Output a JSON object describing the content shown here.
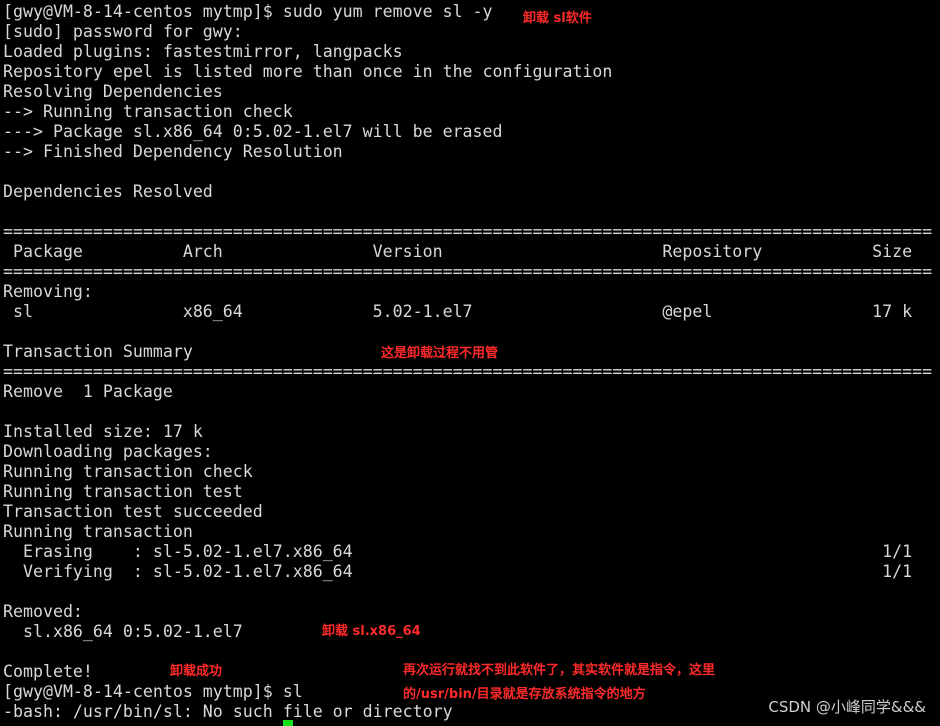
{
  "terminal": {
    "lines": [
      "[gwy@VM-8-14-centos mytmp]$ sudo yum remove sl -y",
      "[sudo] password for gwy:",
      "Loaded plugins: fastestmirror, langpacks",
      "Repository epel is listed more than once in the configuration",
      "Resolving Dependencies",
      "--> Running transaction check",
      "---> Package sl.x86_64 0:5.02-1.el7 will be erased",
      "--> Finished Dependency Resolution",
      "",
      "Dependencies Resolved",
      "",
      "=============================================================================================",
      " Package          Arch               Version                      Repository           Size",
      "=============================================================================================",
      "Removing:",
      " sl               x86_64             5.02-1.el7                   @epel                17 k",
      "",
      "Transaction Summary",
      "=============================================================================================",
      "Remove  1 Package",
      "",
      "Installed size: 17 k",
      "Downloading packages:",
      "Running transaction check",
      "Running transaction test",
      "Transaction test succeeded",
      "Running transaction",
      "  Erasing    : sl-5.02-1.el7.x86_64                                                     1/1",
      "  Verifying  : sl-5.02-1.el7.x86_64                                                     1/1",
      "",
      "Removed:",
      "  sl.x86_64 0:5.02-1.el7",
      "",
      "Complete!",
      "[gwy@VM-8-14-centos mytmp]$ sl",
      "-bash: /usr/bin/sl: No such file or directory"
    ]
  },
  "annotations": [
    "卸载 sl软件",
    "这是卸载过程不用管",
    "卸载 sl.x86_64",
    "卸载成功",
    "再次运行就找不到此软件了，其实软件就是指令，这里",
    "的/usr/bin/目录就是存放系统指令的地方"
  ],
  "watermark": "CSDN @小峰同学&&&",
  "colors": {
    "background": "#000000",
    "text": "#d8d8d8",
    "annotation": "#ff2a2a",
    "cursor": "#18e018"
  }
}
